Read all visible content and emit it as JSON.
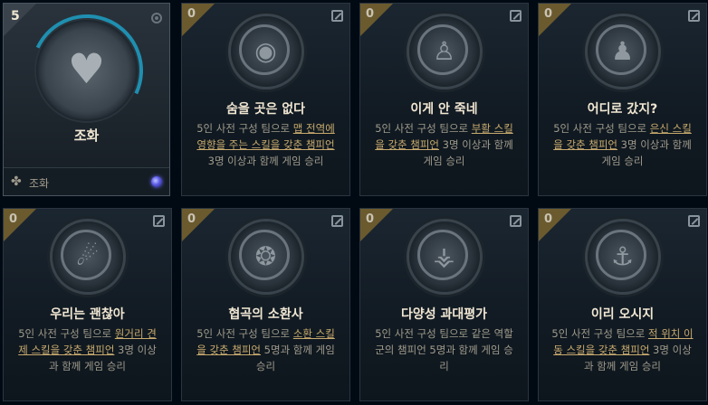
{
  "featured": {
    "level": "5",
    "title": "조화",
    "footer_label": "조화",
    "emblem_icon": "heart-crest-icon",
    "arc_color": "#1f8fb0"
  },
  "cards": [
    {
      "level": "0",
      "title": "숨을 곳은 없다",
      "emblem_icon": "crosshair-eye-icon",
      "desc_pre": "5인 사전 구성 팀으로 ",
      "desc_hl": "맵 전역에 영향을 주는 스킬을 갖춘 챔피언",
      "desc_post": " 3명 이상과 함께 게임 승리"
    },
    {
      "level": "0",
      "title": "이게 안 죽네",
      "emblem_icon": "reviving-figure-icon",
      "desc_pre": "5인 사전 구성 팀으로 ",
      "desc_hl": "부활 스킬을 갖춘 챔피언",
      "desc_post": " 3명 이상과 함께 게임 승리"
    },
    {
      "level": "0",
      "title": "어디로 갔지?",
      "emblem_icon": "hooded-figure-icon",
      "desc_pre": "5인 사전 구성 팀으로 ",
      "desc_hl": "은신 스킬을 갖춘 챔피언",
      "desc_post": " 3명 이상과 함께 게임 승리"
    },
    {
      "level": "0",
      "title": "우리는 괜찮아",
      "emblem_icon": "comet-icon",
      "desc_pre": "5인 사전 구성 팀으로 ",
      "desc_hl": "원거리 견제 스킬을 갖춘 챔피언",
      "desc_post": " 3명 이상과 함께 게임 승리"
    },
    {
      "level": "0",
      "title": "협곡의 소환사",
      "emblem_icon": "bear-icon",
      "desc_pre": "5인 사전 구성 팀으로 ",
      "desc_hl": "소환 스킬을 갖춘 챔피언",
      "desc_post": " 5명과 함께 게임 승리"
    },
    {
      "level": "0",
      "title": "다양성 과대평가",
      "emblem_icon": "arrows-fan-icon",
      "desc_pre": "5인 사전 구성 팀으로 같은 역할군의 챔피언 5명과 함께 게임 승리",
      "desc_hl": "",
      "desc_post": ""
    },
    {
      "level": "0",
      "title": "이리 오시지",
      "emblem_icon": "grab-hook-icon",
      "desc_pre": "5인 사전 구성 팀으로 ",
      "desc_hl": "적 위치 이동 스킬을 갖춘 챔피언",
      "desc_post": " 3명 이상과 함께 게임 승리"
    }
  ],
  "colors": {
    "gold_corner": "#6b5a2e",
    "highlight": "#c8aa6e",
    "title": "#f0e6d2",
    "body_text": "#a09b8c"
  }
}
